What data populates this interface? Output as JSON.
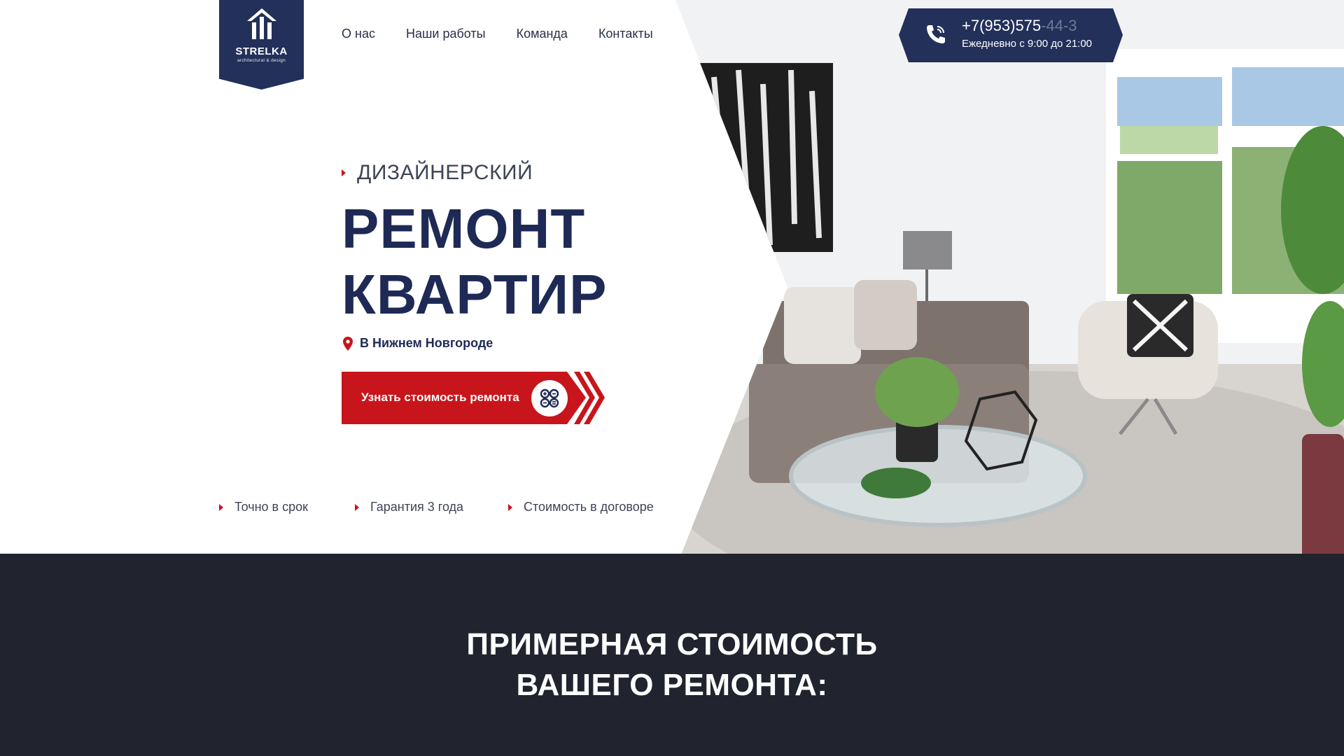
{
  "logo": {
    "name": "STRELKA",
    "tagline": "architectural & design"
  },
  "nav": {
    "items": [
      "О нас",
      "Наши работы",
      "Команда",
      "Контакты"
    ]
  },
  "phone": {
    "number_visible": "+7(953)575",
    "number_faded": "-44-3",
    "hours": "Ежедневно с 9:00 до 21:00"
  },
  "hero": {
    "kicker": "ДИЗАЙНЕРСКИЙ",
    "title_line1": "РЕМОНТ",
    "title_line2": "КВАРТИР",
    "location": "В Нижнем Новгороде",
    "cta_label": "Узнать стоимость ремонта"
  },
  "features": [
    "Точно в срок",
    "Гарантия 3 года",
    "Стоимость в договоре"
  ],
  "pricing": {
    "title_line1": "ПРИМЕРНАЯ СТОИМОСТЬ",
    "title_line2": "ВАШЕГО РЕМОНТА:"
  },
  "colors": {
    "navy": "#22305a",
    "red": "#c8151b",
    "dark_bg": "#21242f"
  }
}
